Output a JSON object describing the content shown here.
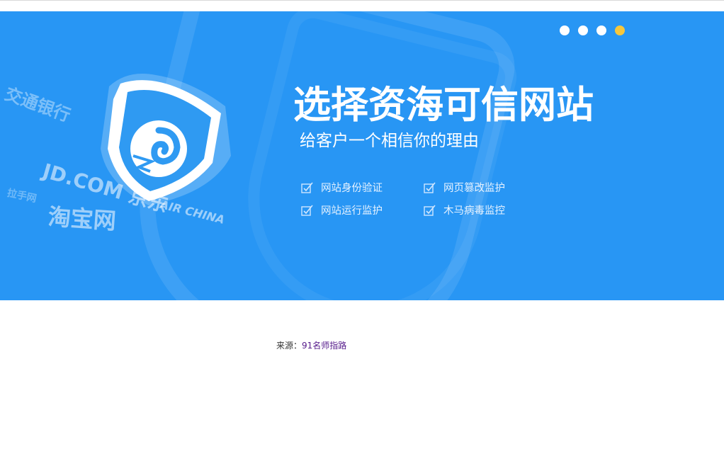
{
  "banner": {
    "headline": "选择资海可信网站",
    "subheadline": "给客户一个相信你的理由",
    "features": [
      "网站身份验证",
      "网页篡改监护",
      "网站运行监护",
      "木马病毒监控"
    ],
    "partner_logos": [
      "交通银行",
      "JD.COM 京东",
      "淘宝网",
      "AIR CHINA",
      "拉手网"
    ],
    "background_color": "#2896f4"
  },
  "carousel": {
    "slide_count": 4,
    "active_index": 4,
    "indicator_color": "#ffffff",
    "active_color": "#f6c73c"
  },
  "source": {
    "label": "来源：",
    "link_text": "91名师指路"
  }
}
